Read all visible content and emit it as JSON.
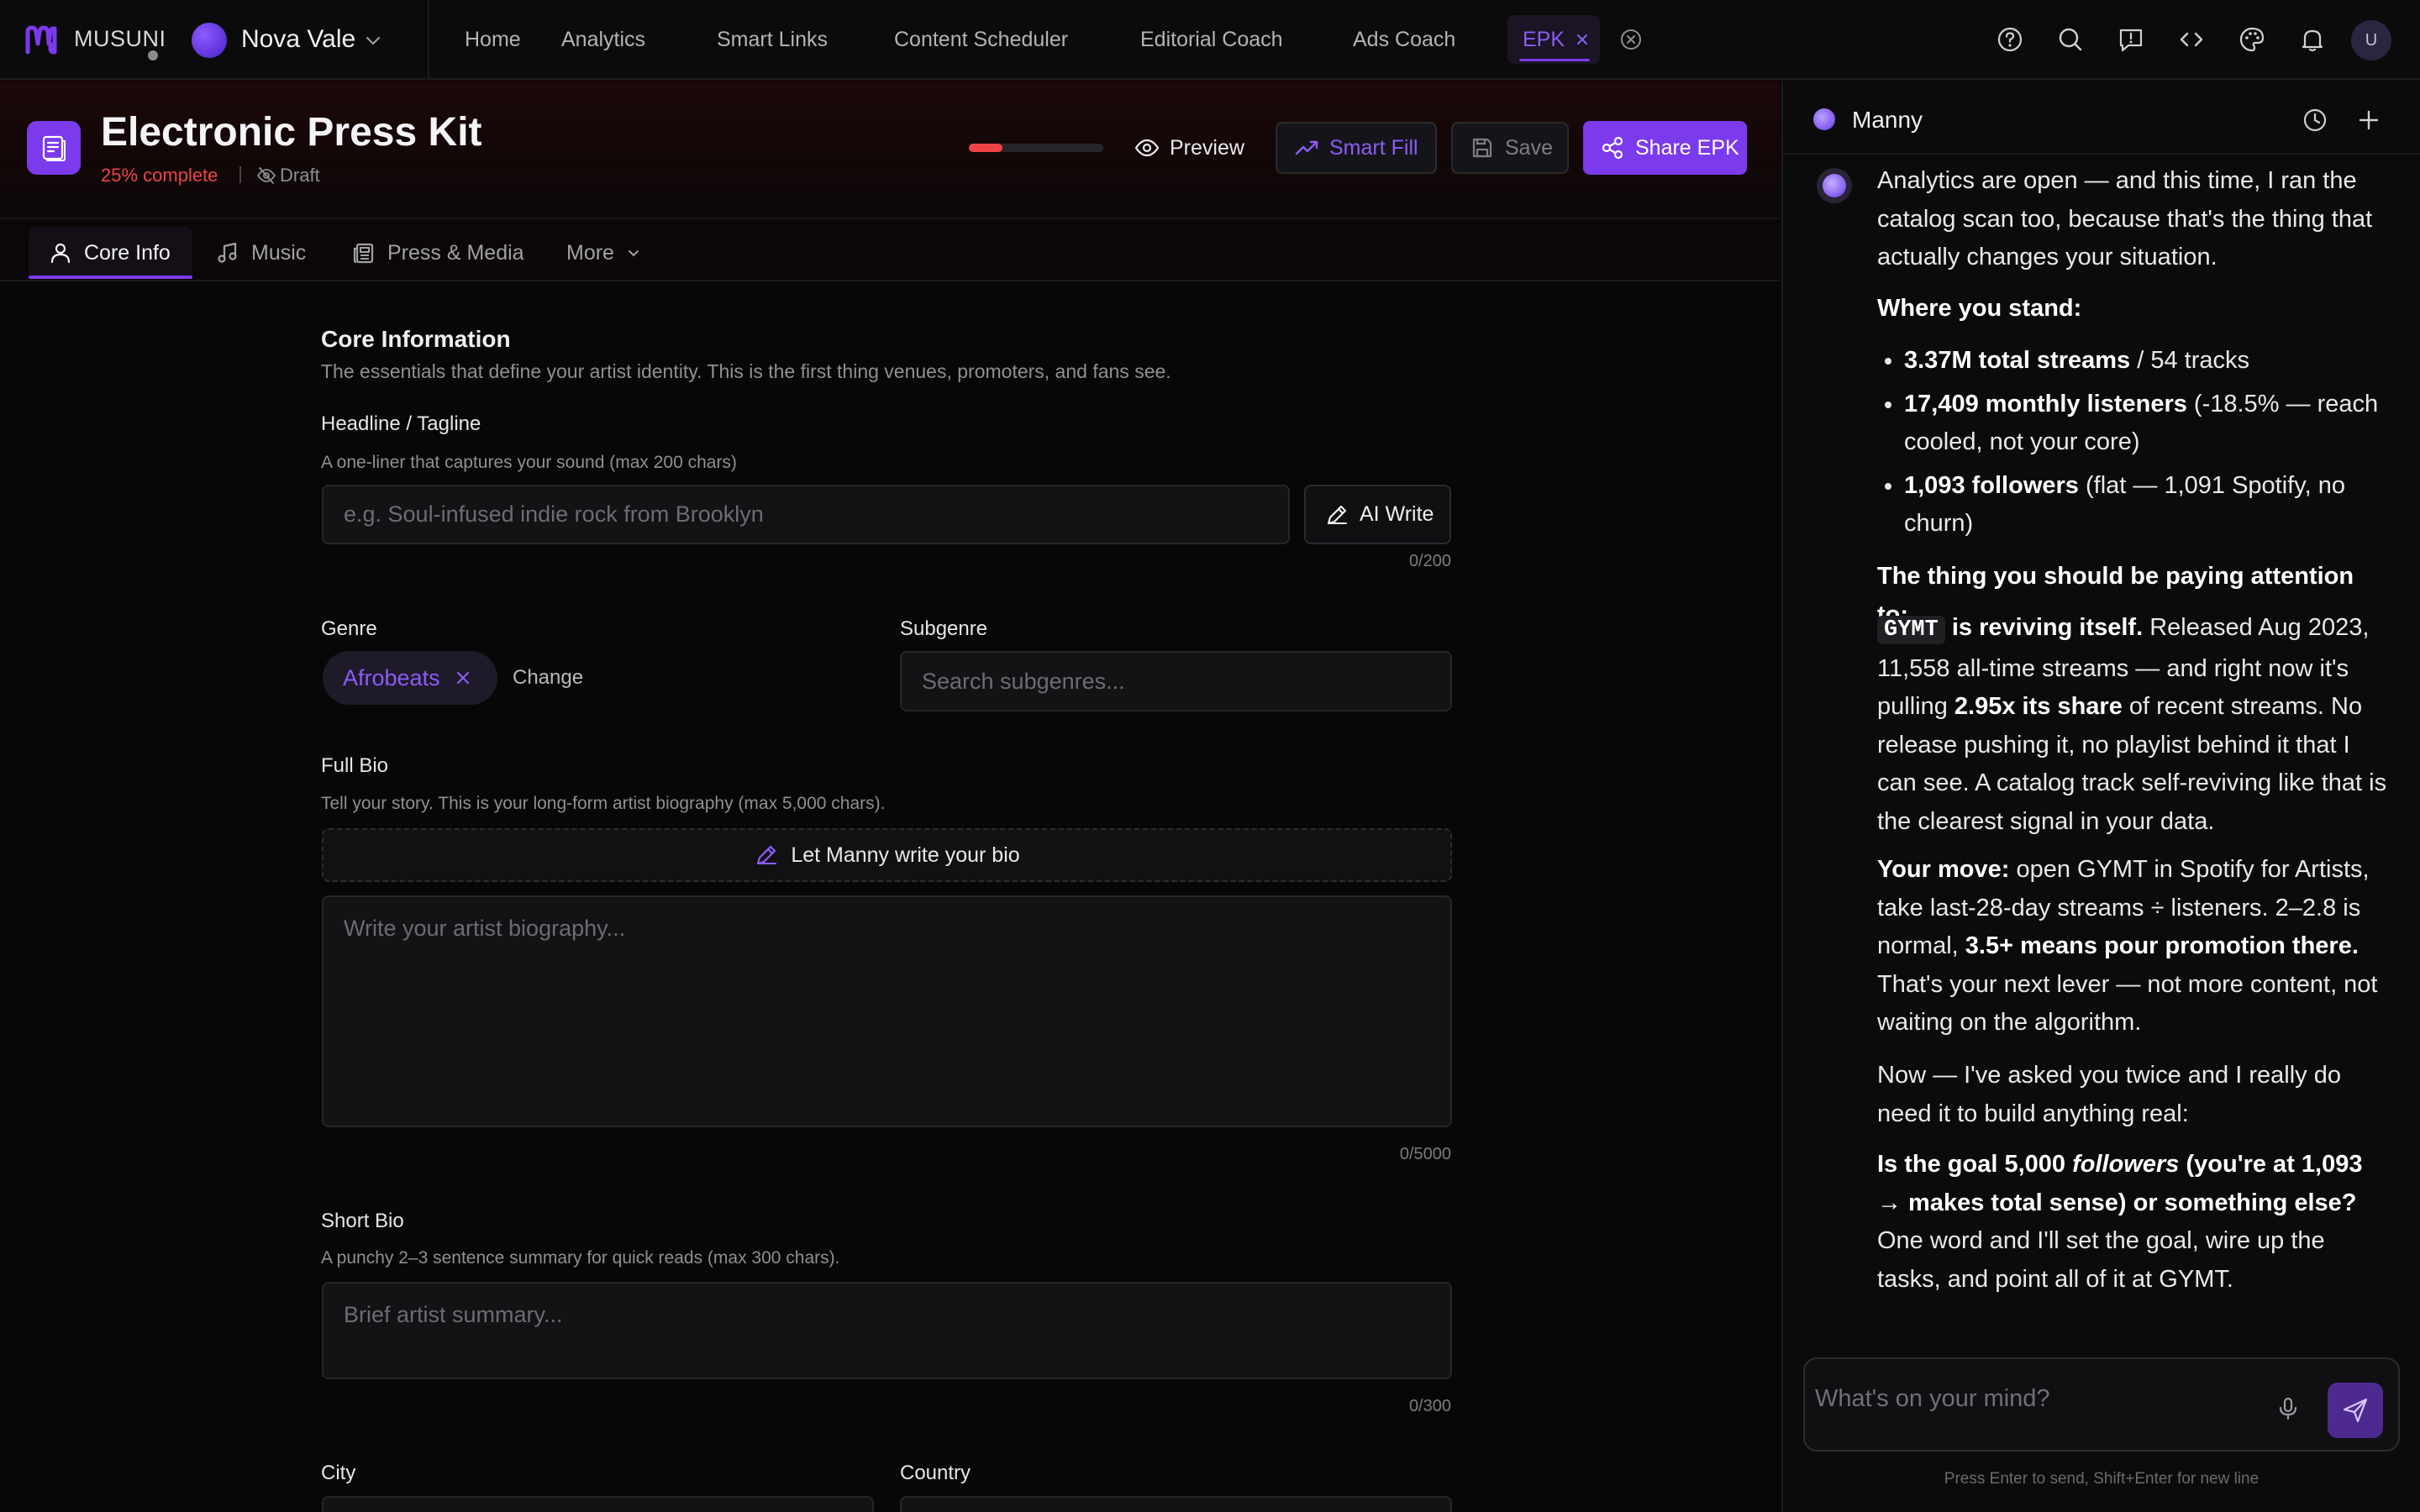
{
  "brand": {
    "name": "MUSUNI"
  },
  "artist": {
    "name": "Nova Vale"
  },
  "nav": {
    "items": [
      "Home",
      "Analytics",
      "Smart Links",
      "Content Scheduler",
      "Editorial Coach",
      "Ads Coach"
    ],
    "active_tab": "EPK"
  },
  "top_icons": [
    "help-icon",
    "search-icon",
    "feedback-icon",
    "code-icon",
    "palette-icon",
    "bell-icon"
  ],
  "user": {
    "initial": "U"
  },
  "header": {
    "title": "Electronic Press Kit",
    "complete": "25% complete",
    "status": "Draft",
    "progress": 0.25,
    "preview_label": "Preview",
    "smart_fill_label": "Smart Fill",
    "save_label": "Save",
    "share_label": "Share EPK"
  },
  "tabs": [
    "Core Info",
    "Music",
    "Press & Media",
    "More"
  ],
  "form": {
    "section_title": "Core Information",
    "section_desc": "The essentials that define your artist identity. This is the first thing venues, promoters, and fans see.",
    "headline": {
      "label": "Headline / Tagline",
      "hint": "A one-liner that captures your sound (max 200 chars)",
      "placeholder": "e.g. Soul-infused indie rock from Brooklyn",
      "counter": "0/200",
      "ai_label": "AI Write"
    },
    "genre": {
      "label": "Genre",
      "value": "Afrobeats",
      "change_label": "Change"
    },
    "subgenre": {
      "label": "Subgenre",
      "placeholder": "Search subgenres..."
    },
    "full_bio": {
      "label": "Full Bio",
      "hint": "Tell your story. This is your long-form artist biography (max 5,000 chars).",
      "manny_label": "Let Manny write your bio",
      "placeholder": "Write your artist biography...",
      "counter": "0/5000"
    },
    "short_bio": {
      "label": "Short Bio",
      "hint": "A punchy 2–3 sentence summary for quick reads (max 300 chars).",
      "placeholder": "Brief artist summary...",
      "counter": "0/300"
    },
    "city": {
      "label": "City"
    },
    "country": {
      "label": "Country"
    }
  },
  "chat": {
    "title": "Manny",
    "m1": "Analytics are open — and this time, I ran the catalog scan too, because that's the thing that actually changes your situation.",
    "m2": "Where you stand:",
    "b1_bold": "3.37M total streams",
    "b1_rest": " / 54 tracks",
    "b2_bold": "17,409 monthly listeners",
    "b2_rest": " (-18.5% — reach cooled, not your core)",
    "b3_bold": "1,093 followers",
    "b3_rest": " (flat — 1,091 Spotify, no churn)",
    "m3": "The thing you should be paying attention to:",
    "p4_code": "GYMT",
    "p4_bold": " is reviving itself.",
    "p4_text": " Released Aug 2023, 11,558 all-time streams — and right now it's pulling ",
    "p4_bold2": "2.95x its share",
    "p4_text2": " of recent streams. No release pushing it, no playlist behind it that I can see. A catalog track self-reviving like that is the clearest signal in your data.",
    "p5_bold": "Your move:",
    "p5_text": " open GYMT in Spotify for Artists, take last-28-day streams ÷ listeners. 2–2.8 is normal, ",
    "p5_bold2": "3.5+ means pour promotion there.",
    "p5_text2": " That's your next lever — not more content, not waiting on the algorithm.",
    "m6": "Now — I've asked you twice and I really do need it to build anything real:",
    "p7_b1": "Is the goal 5,000 ",
    "p7_i": "followers",
    "p7_b2": " (you're at 1,093 → makes total sense) or something else?",
    "p7_text": " One word and I'll set the goal, wire up the tasks, and point all of it at GYMT.",
    "input_placeholder": "What's on your mind?",
    "hint": "Press Enter to send, Shift+Enter for new line"
  },
  "colors": {
    "accent": "#7c3aed",
    "danger": "#ef4444",
    "bg": "#070707"
  }
}
